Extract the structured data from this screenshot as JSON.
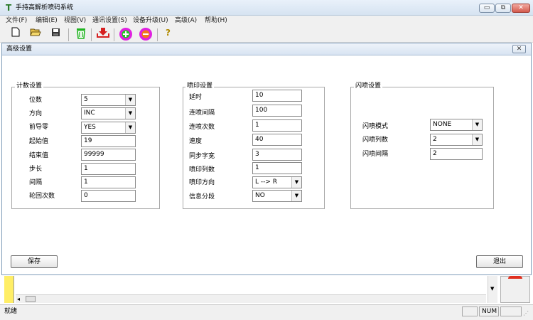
{
  "window": {
    "title": "手持高解析喷码系统",
    "icon": "T",
    "controls": {
      "minimize": "▭",
      "restore": "⧉",
      "close": "✕"
    }
  },
  "menu": [
    "文件(F)",
    "编辑(E)",
    "视图(V)",
    "通讯设置(S)",
    "设备升级(U)",
    "高级(A)",
    "帮助(H)"
  ],
  "toolbar": {
    "new": "new-file-icon",
    "open": "open-folder-icon",
    "save": "save-disk-icon",
    "delete": "trash-icon",
    "download": "download-icon",
    "add": "add-circle-icon",
    "remove": "remove-circle-icon",
    "help": "help-icon"
  },
  "dialog": {
    "title": "高级设置",
    "close": "✕",
    "count_group": {
      "title": "计数设置",
      "rows": [
        {
          "label": "位数",
          "value": "5",
          "type": "select"
        },
        {
          "label": "方向",
          "value": "INC",
          "type": "select"
        },
        {
          "label": "前导零",
          "value": "YES",
          "type": "select"
        },
        {
          "label": "起始值",
          "value": "19",
          "type": "input"
        },
        {
          "label": "结束值",
          "value": "99999",
          "type": "input"
        },
        {
          "label": "步长",
          "value": "1",
          "type": "input"
        },
        {
          "label": "间隔",
          "value": "1",
          "type": "input"
        },
        {
          "label": "轮回次数",
          "value": "0",
          "type": "input"
        }
      ]
    },
    "print_group": {
      "title": "喷印设置",
      "rows": [
        {
          "label": "延时",
          "value": "10",
          "type": "input"
        },
        {
          "label": "连喷间隔",
          "value": "100",
          "type": "input"
        },
        {
          "label": "连喷次数",
          "value": "1",
          "type": "input"
        },
        {
          "label": "速度",
          "value": "40",
          "type": "input"
        },
        {
          "label": "同步字宽",
          "value": "3",
          "type": "input"
        },
        {
          "label": "喷印列数",
          "value": "1",
          "type": "input"
        },
        {
          "label": "喷印方向",
          "value": "L --> R",
          "type": "select"
        },
        {
          "label": "信息分段",
          "value": "NO",
          "type": "select"
        }
      ]
    },
    "flash_group": {
      "title": "闪喷设置",
      "rows": [
        {
          "label": "闪喷模式",
          "value": "NONE",
          "type": "select"
        },
        {
          "label": "闪喷列数",
          "value": "2",
          "type": "select"
        },
        {
          "label": "闪喷间隔",
          "value": "2",
          "type": "input"
        }
      ]
    },
    "save_button": "保存",
    "exit_button": "退出"
  },
  "status": {
    "text": "就绪",
    "num": "NUM"
  }
}
